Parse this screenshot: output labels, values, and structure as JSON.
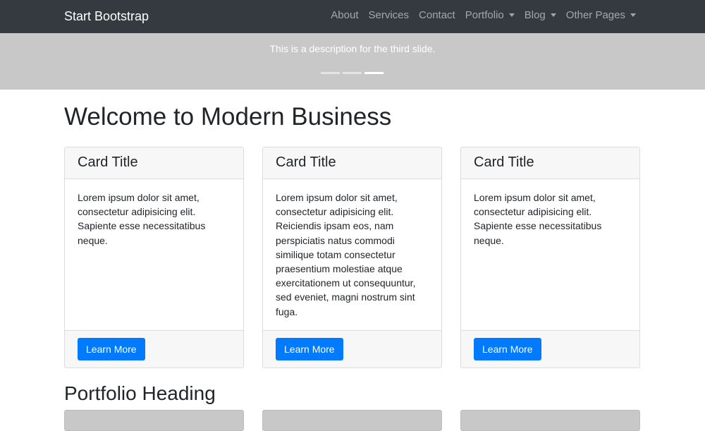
{
  "navbar": {
    "brand": "Start Bootstrap",
    "items": [
      {
        "label": "About",
        "dropdown": false
      },
      {
        "label": "Services",
        "dropdown": false
      },
      {
        "label": "Contact",
        "dropdown": false
      },
      {
        "label": "Portfolio",
        "dropdown": true
      },
      {
        "label": "Blog",
        "dropdown": true
      },
      {
        "label": "Other Pages",
        "dropdown": true
      }
    ]
  },
  "carousel": {
    "caption": "This is a description for the third slide.",
    "indicator_count": 3,
    "active_index": 2
  },
  "main": {
    "title": "Welcome to Modern Business",
    "cards": [
      {
        "title": "Card Title",
        "body": "Lorem ipsum dolor sit amet, consectetur adipisicing elit. Sapiente esse necessitatibus neque.",
        "button": "Learn More"
      },
      {
        "title": "Card Title",
        "body": "Lorem ipsum dolor sit amet, consectetur adipisicing elit. Reiciendis ipsam eos, nam perspiciatis natus commodi similique totam consectetur praesentium molestiae atque exercitationem ut consequuntur, sed eveniet, magni nostrum sint fuga.",
        "button": "Learn More"
      },
      {
        "title": "Card Title",
        "body": "Lorem ipsum dolor sit amet, consectetur adipisicing elit. Sapiente esse necessitatibus neque.",
        "button": "Learn More"
      }
    ],
    "portfolio_heading": "Portfolio Heading"
  },
  "colors": {
    "navbar_bg": "#343a40",
    "carousel_bg": "#c8c8c8",
    "primary": "#007bff",
    "card_header_bg": "#f7f7f7"
  }
}
